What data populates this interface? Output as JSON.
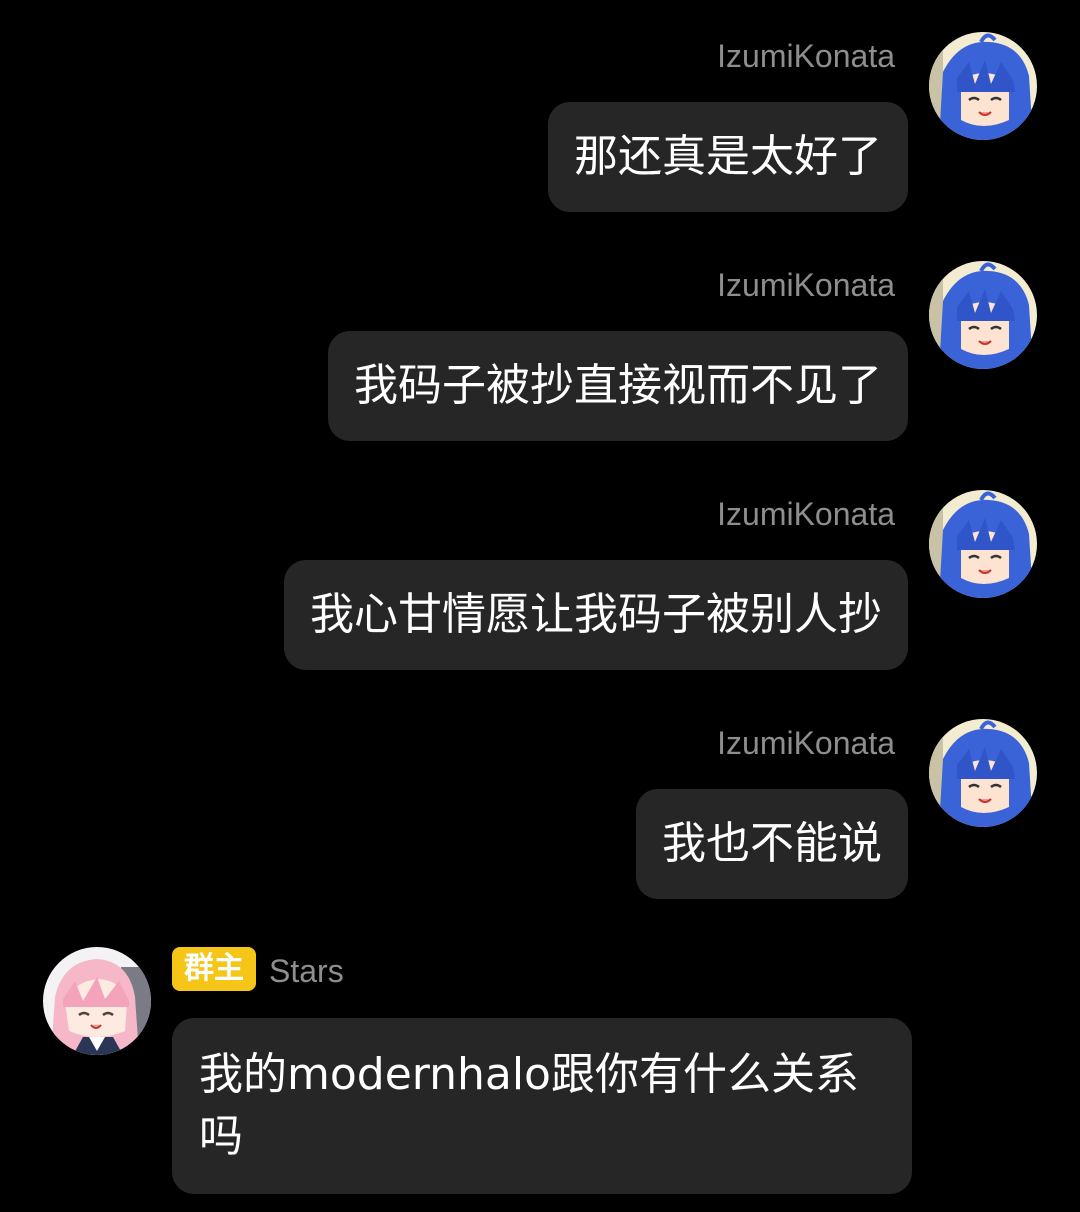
{
  "messages": [
    {
      "sender": "IzumiKonata",
      "text": "那还真是太好了"
    },
    {
      "sender": "IzumiKonata",
      "text": "我码子被抄直接视而不见了"
    },
    {
      "sender": "IzumiKonata",
      "text": "我心甘情愿让我码子被别人抄"
    },
    {
      "sender": "IzumiKonata",
      "text": "我也不能说"
    },
    {
      "sender": "Stars",
      "badge": "群主",
      "text": "我的modernhalo跟你有什么关系吗"
    }
  ],
  "colors": {
    "background": "#000000",
    "bubble": "#262626",
    "sender_name": "#8e8e8e",
    "badge": "#f5c518",
    "text": "#ffffff"
  },
  "icons": {
    "konata_avatar": "anime-avatar-blue-hair",
    "stars_avatar": "anime-avatar-pink-hair"
  }
}
